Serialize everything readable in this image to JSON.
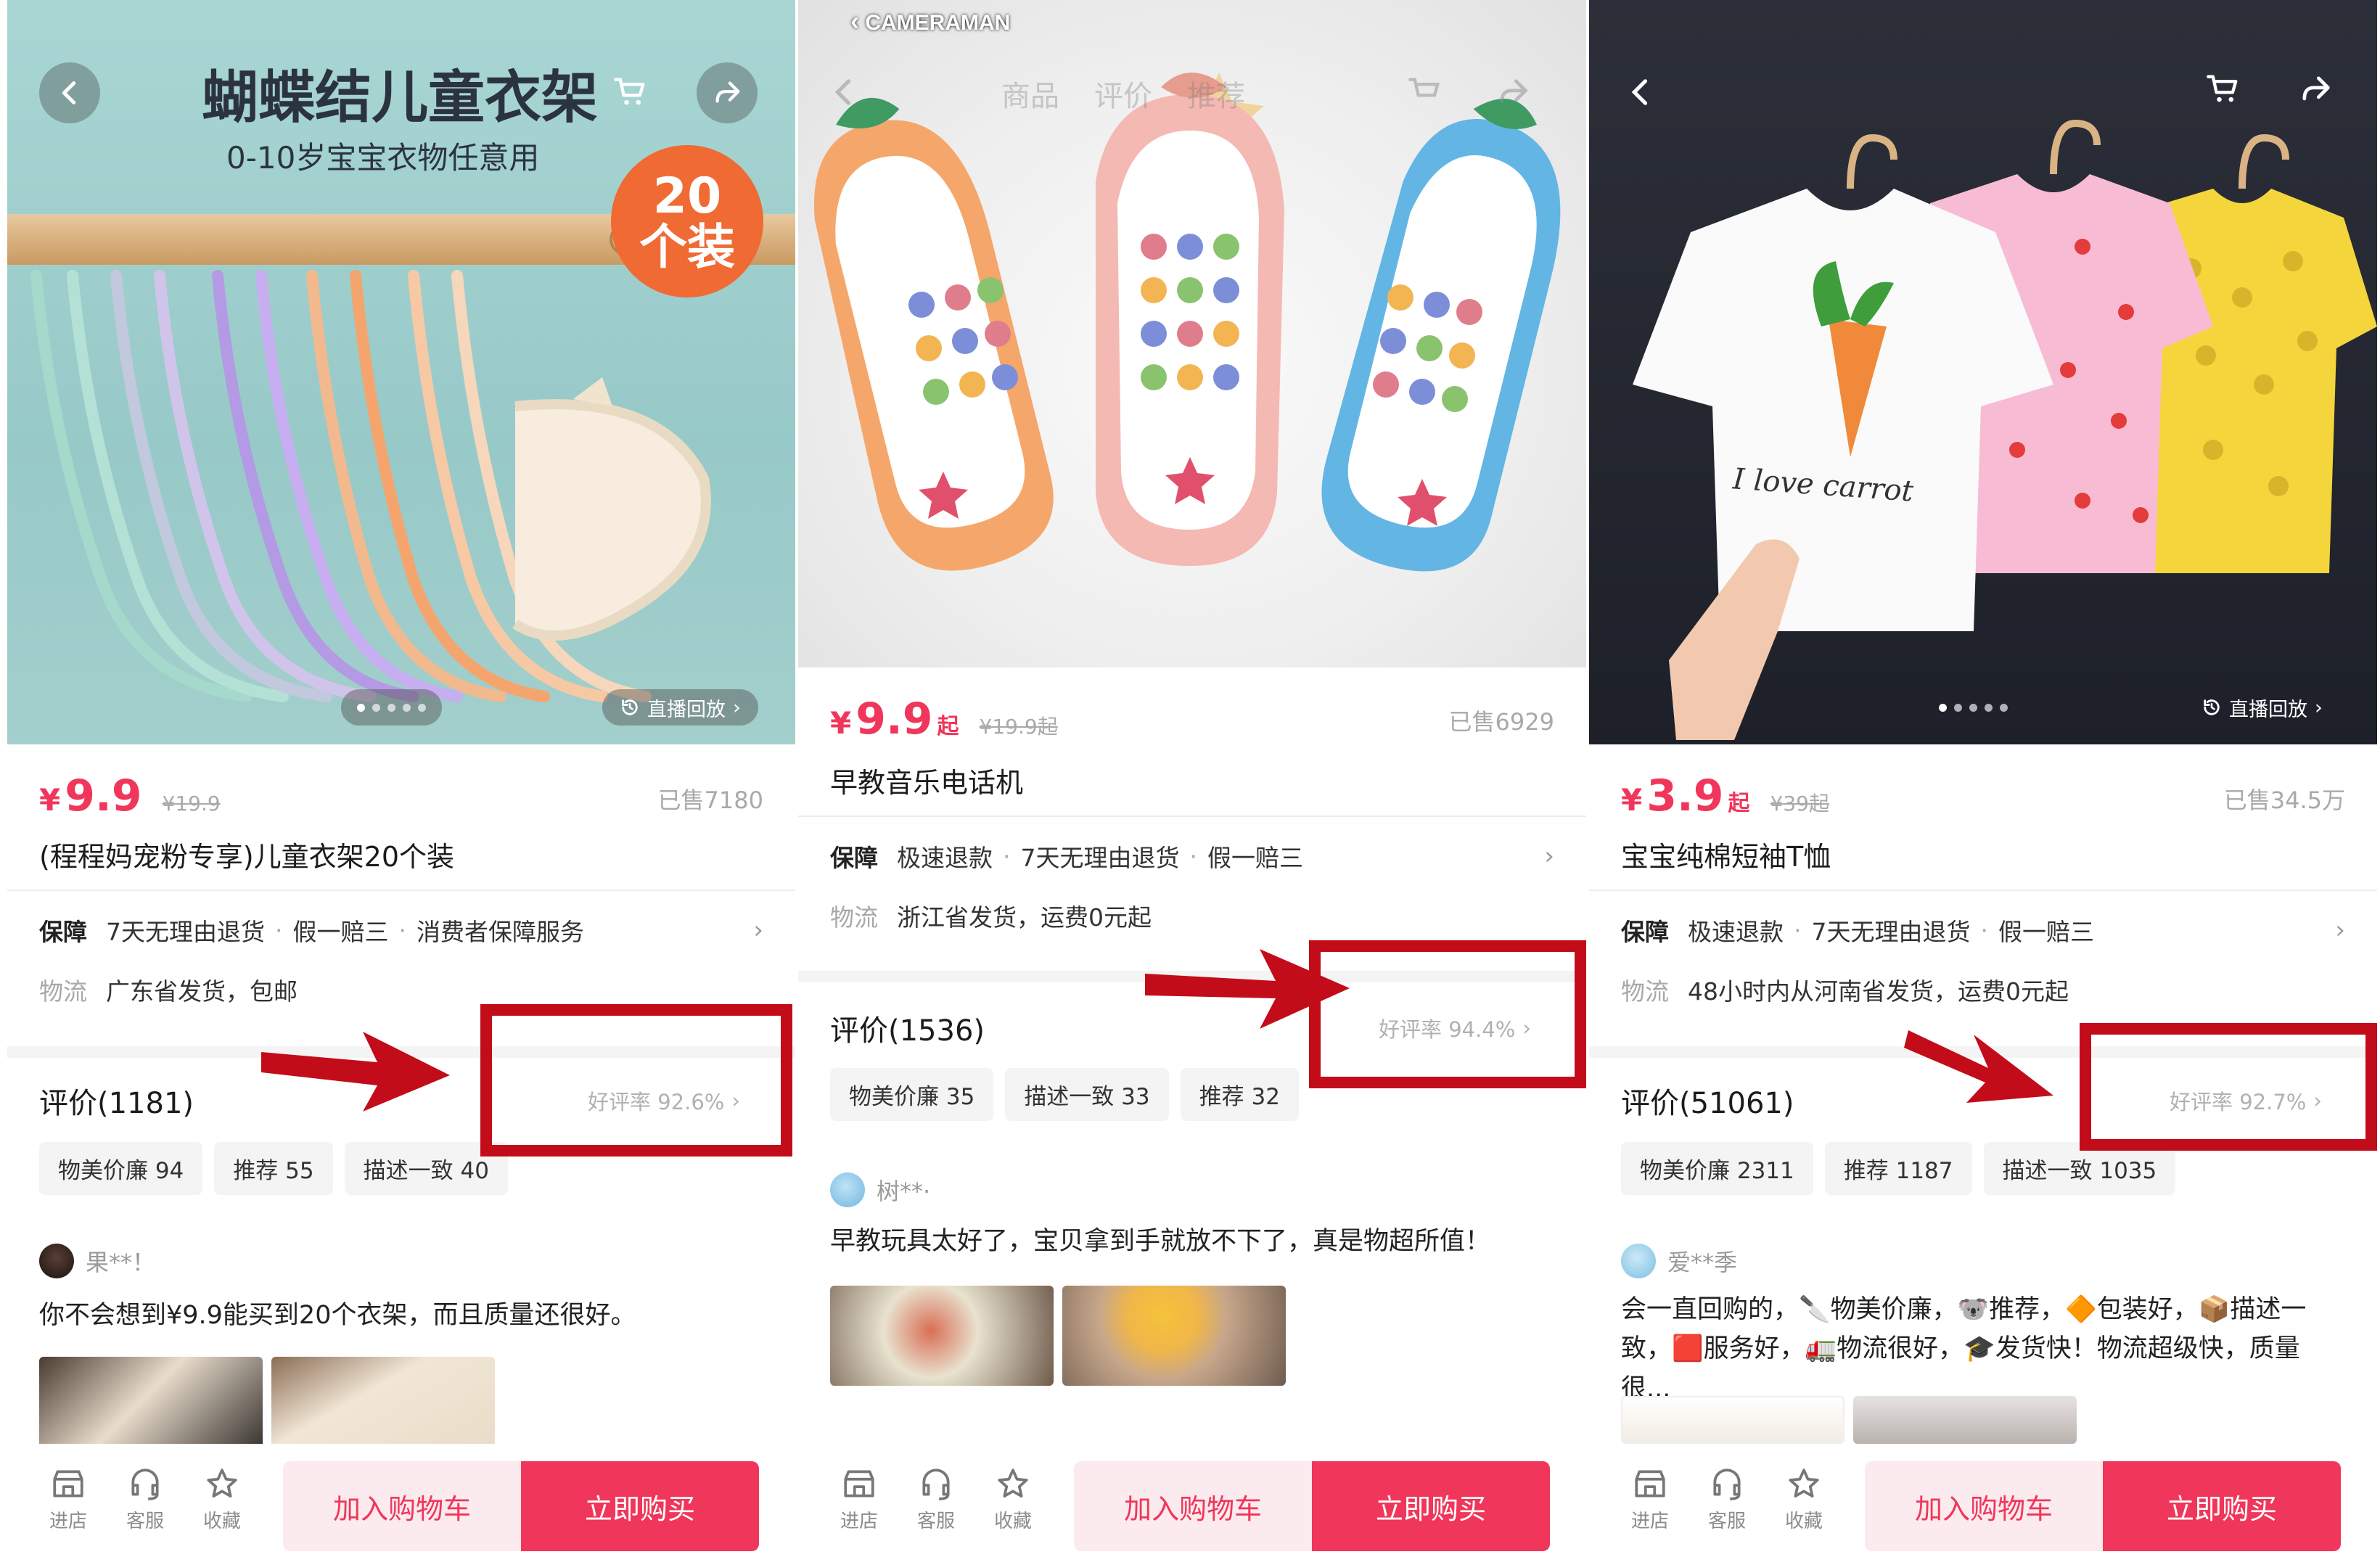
{
  "common": {
    "guarantee_label": "保障",
    "logistics_label": "物流",
    "replay_label": "直播回放",
    "store_label": "进店",
    "service_label": "客服",
    "favorite_label": "收藏",
    "add_cart_label": "加入购物车",
    "buy_now_label": "立即购买",
    "chevron": "›"
  },
  "p1": {
    "hero_title": "蝴蝶结儿童衣架",
    "hero_subtitle": "0-10岁宝宝衣物任意用",
    "badge_line1": "20",
    "badge_line2": "个装",
    "yen": "¥",
    "price": "9.9",
    "orig_price": "¥19.9",
    "sold": "已售7180",
    "title": "(程程妈宠粉专享)儿童衣架20个装",
    "guarantees": [
      "7天无理由退货",
      "假一赔三",
      "消费者保障服务"
    ],
    "logistics": "广东省发货，包邮",
    "reviews_heading": "评价(1181)",
    "good_rate": "好评率 92.6%",
    "chips": [
      "物美价廉 94",
      "推荐 55",
      "描述一致 40"
    ],
    "reviewer": "果**！",
    "review_text": "你不会想到¥9.9能买到20个衣架，而且质量还很好。"
  },
  "p2": {
    "camera_tag": "CAMERAMAN",
    "tabs": [
      "商品",
      "评价",
      "推荐"
    ],
    "yen": "¥",
    "price": "9.9",
    "qi": "起",
    "orig_price": "¥19.9起",
    "sold": "已售6929",
    "title": "早教音乐电话机",
    "guarantees": [
      "极速退款",
      "7天无理由退货",
      "假一赔三"
    ],
    "logistics": "浙江省发货，运费0元起",
    "reviews_heading": "评价(1536)",
    "good_rate": "好评率 94.4%",
    "chips": [
      "物美价廉 35",
      "描述一致 33",
      "推荐 32"
    ],
    "reviewer": "树**·",
    "review_text": "早教玩具太好了，宝贝拿到手就放不下了，真是物超所值！"
  },
  "p3": {
    "shirt_text": "I love carrot",
    "yen": "¥",
    "price": "3.9",
    "qi": "起",
    "orig_price": "¥39起",
    "sold": "已售34.5万",
    "title": "宝宝纯棉短袖T恤",
    "guarantees": [
      "极速退款",
      "7天无理由退货",
      "假一赔三"
    ],
    "logistics": "48小时内从河南省发货，运费0元起",
    "reviews_heading": "评价(51061)",
    "good_rate": "好评率 92.7%",
    "chips": [
      "物美价廉 2311",
      "推荐 1187",
      "描述一致 1035"
    ],
    "reviewer": "爱**季",
    "review_text": "会一直回购的，🔪物美价廉，🐨推荐，🔶包装好，📦描述一致，🟥服务好，🚛物流很好，🎓发货快！物流超级快，质量很..."
  },
  "colors": {
    "accent": "#f0365a",
    "highlight": "#c30c19",
    "muted": "#a9a9a9"
  }
}
